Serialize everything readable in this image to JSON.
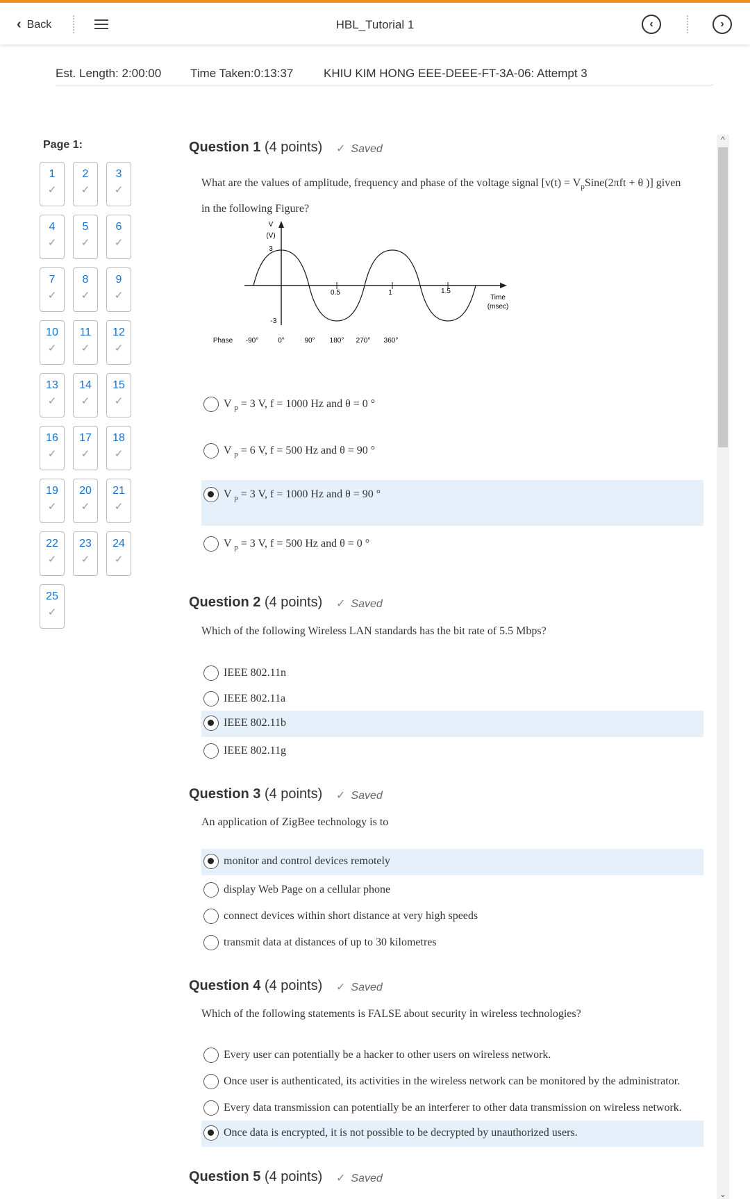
{
  "header": {
    "back_label": "Back",
    "title": "HBL_Tutorial 1",
    "prev_glyph": "‹",
    "next_glyph": "›"
  },
  "info": {
    "est_length": "Est. Length: 2:00:00",
    "time_taken": "Time Taken:0:13:37",
    "attempt": "KHIU KIM HONG EEE-DEEE-FT-3A-06: Attempt 3"
  },
  "sidebar": {
    "page_label": "Page 1:",
    "questions": [
      "1",
      "2",
      "3",
      "4",
      "5",
      "6",
      "7",
      "8",
      "9",
      "10",
      "11",
      "12",
      "13",
      "14",
      "15",
      "16",
      "17",
      "18",
      "19",
      "20",
      "21",
      "22",
      "23",
      "24",
      "25"
    ],
    "check_glyph": "✓"
  },
  "q1": {
    "title": "Question 1",
    "points": "(4 points)",
    "saved": "Saved",
    "text_line1_pre": "What are the values of amplitude, frequency and phase of the voltage signal [v(t) = V",
    "text_line1_sub": "p",
    "text_line1_post": "Sine(2πft + θ )] given",
    "text_line2": "in the following Figure?",
    "figure": {
      "y_axis_label": "V",
      "y_axis_unit": "(V)",
      "y_max": "3",
      "y_min": "-3",
      "x_ticks": [
        "0.5",
        "1",
        "1.5"
      ],
      "x_axis_label": "Time",
      "x_axis_unit": "(msec)",
      "phase_label": "Phase",
      "phase_ticks": [
        "-90°",
        "0°",
        "90°",
        "180°",
        "270°",
        "360°"
      ]
    },
    "options": [
      {
        "pre": "V ",
        "sub": "p",
        "post": " = 3 V, f = 1000 Hz and θ = 0 °",
        "selected": false
      },
      {
        "pre": "V ",
        "sub": "p",
        "post": " = 6 V, f = 500 Hz and θ = 90 °",
        "selected": false
      },
      {
        "pre": "V ",
        "sub": "p",
        "post": " = 3 V, f = 1000 Hz and θ = 90 °",
        "selected": true
      },
      {
        "pre": "V ",
        "sub": "p",
        "post": " = 3 V, f = 500 Hz and θ = 0 °",
        "selected": false
      }
    ]
  },
  "q2": {
    "title": "Question 2",
    "points": "(4 points)",
    "saved": "Saved",
    "text": "Which of the following Wireless LAN standards has the bit rate of 5.5 Mbps?",
    "options": [
      "IEEE 802.11n",
      "IEEE 802.11a",
      "IEEE 802.11b",
      "IEEE 802.11g"
    ],
    "selected_index": 2
  },
  "q3": {
    "title": "Question 3",
    "points": "(4 points)",
    "saved": "Saved",
    "text": "An application of ZigBee technology is to",
    "options": [
      "monitor and control devices remotely",
      "display Web Page on a cellular phone",
      "connect devices within short distance at very high speeds",
      "transmit data at distances of up to 30 kilometres"
    ],
    "selected_index": 0
  },
  "q4": {
    "title": "Question 4",
    "points": "(4 points)",
    "saved": "Saved",
    "text": "Which of the following statements is FALSE about security in wireless technologies?",
    "options": [
      "Every user can potentially be a hacker to other users on wireless network.",
      "Once user is authenticated, its activities in the wireless network can be monitored by the administrator.",
      "Every data transmission can potentially be an interferer to other data transmission on wireless network.",
      "Once data is encrypted, it is not possible to be decrypted by unauthorized users."
    ],
    "selected_index": 3
  },
  "q5": {
    "title": "Question 5",
    "points": "(4 points)",
    "saved": "Saved"
  }
}
